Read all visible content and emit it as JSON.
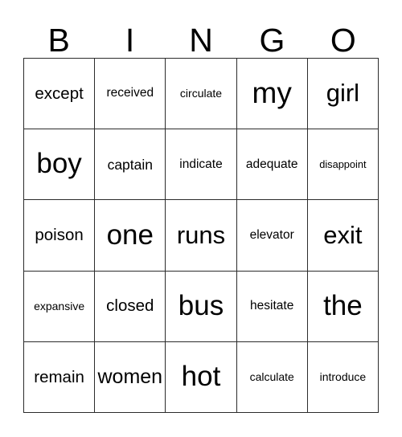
{
  "card": {
    "title": "BINGO",
    "header_letters": [
      "B",
      "I",
      "N",
      "G",
      "O"
    ],
    "columns": 5,
    "rows": 5,
    "colors": {
      "background": "#ffffff",
      "text": "#000000",
      "grid_line": "#2b2b2b"
    },
    "cells": [
      [
        {
          "word": "except"
        },
        {
          "word": "received"
        },
        {
          "word": "circulate"
        },
        {
          "word": "my"
        },
        {
          "word": "girl"
        }
      ],
      [
        {
          "word": "boy"
        },
        {
          "word": "captain"
        },
        {
          "word": "indicate"
        },
        {
          "word": "adequate"
        },
        {
          "word": "disappoint"
        }
      ],
      [
        {
          "word": "poison"
        },
        {
          "word": "one"
        },
        {
          "word": "runs"
        },
        {
          "word": "elevator"
        },
        {
          "word": "exit"
        }
      ],
      [
        {
          "word": "expansive"
        },
        {
          "word": "closed"
        },
        {
          "word": "bus"
        },
        {
          "word": "hesitate"
        },
        {
          "word": "the"
        }
      ],
      [
        {
          "word": "remain"
        },
        {
          "word": "women"
        },
        {
          "word": "hot"
        },
        {
          "word": "calculate"
        },
        {
          "word": "introduce"
        }
      ]
    ]
  }
}
